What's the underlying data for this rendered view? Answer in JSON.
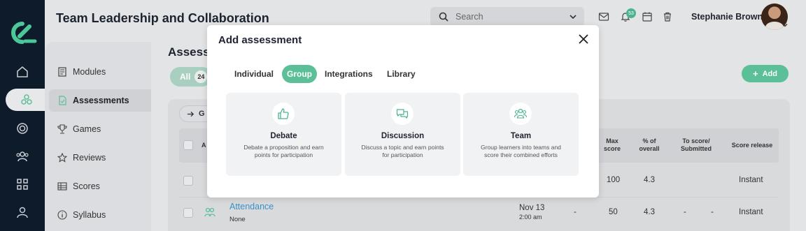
{
  "header": {
    "title": "Team Leadership and Collaboration",
    "search_placeholder": "Search",
    "notification_count": "53",
    "user_name": "Stephanie Brown"
  },
  "rail": {
    "icons": [
      "logo-icon",
      "home-icon",
      "courses-icon",
      "target-icon",
      "people-icon",
      "grid-icon",
      "user-icon"
    ],
    "active": "courses-icon"
  },
  "sidebar": {
    "items": [
      {
        "label": "Modules",
        "icon": "modules-icon"
      },
      {
        "label": "Assessments",
        "icon": "assessments-icon"
      },
      {
        "label": "Games",
        "icon": "trophy-icon"
      },
      {
        "label": "Reviews",
        "icon": "star-icon"
      },
      {
        "label": "Scores",
        "icon": "table-icon"
      },
      {
        "label": "Syllabus",
        "icon": "info-icon"
      }
    ],
    "active": "Assessments"
  },
  "main": {
    "heading": "Assess",
    "tab_all_label": "All",
    "tab_all_count": "24",
    "add_label": "Add",
    "go_label": "G",
    "table": {
      "headers": {
        "col_a": "A",
        "max_score": "Max score",
        "pct_overall": "% of overall",
        "to_score": "To score/ Submitted",
        "score_release": "Score release"
      },
      "rows": [
        {
          "name": "",
          "sub": "",
          "date": "",
          "time": "",
          "dash": "",
          "max": "100",
          "pct": "4.3",
          "to_score": "",
          "submitted": "",
          "release": "Instant"
        },
        {
          "name": "Attendance",
          "sub": "None",
          "date": "Nov 13",
          "time": "2:00 am",
          "dash": "-",
          "max": "50",
          "pct": "4.3",
          "to_score": "-",
          "submitted": "-",
          "release": "Instant"
        }
      ]
    }
  },
  "modal": {
    "title": "Add assessment",
    "tabs": [
      "Individual",
      "Group",
      "Integrations",
      "Library"
    ],
    "active_tab": "Group",
    "options": [
      {
        "title": "Debate",
        "desc": "Debate a proposition and earn points for participation",
        "icon": "thumbs-up-icon"
      },
      {
        "title": "Discussion",
        "desc": "Discuss a topic and earn points for participation",
        "icon": "chat-bubbles-icon"
      },
      {
        "title": "Team",
        "desc": "Group learners into teams and score their combined efforts",
        "icon": "team-icon"
      }
    ]
  },
  "colors": {
    "accent": "#5bbf98",
    "rail": "#0d1b2a",
    "overlay_bg": "#e3e4e6",
    "modal_bg": "#ffffff",
    "option_bg": "#f1f2f4"
  }
}
